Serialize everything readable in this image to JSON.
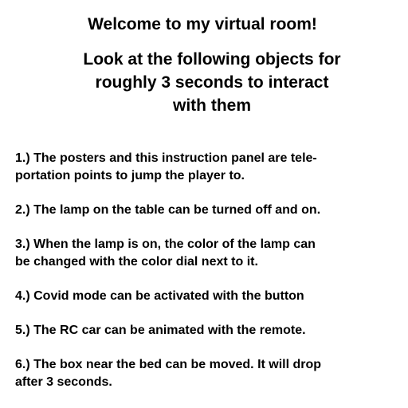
{
  "panel": {
    "title": "Welcome to my virtual room!",
    "subtitle_lines": [
      "Look at the following objects for",
      "roughly 3 seconds to interact",
      "with them"
    ],
    "instructions": [
      [
        "1.) The posters and this instruction panel are tele-",
        "portation points to jump the player to."
      ],
      [
        "2.) The lamp on the table can be turned off and on."
      ],
      [
        "3.) When the lamp is on, the color of the lamp can",
        "be changed with the color dial next to it."
      ],
      [
        "4.) Covid mode can be activated with the button"
      ],
      [
        "5.) The RC car can be animated with the remote."
      ],
      [
        "6.) The box near the bed can be moved. It will drop",
        "after 3 seconds."
      ]
    ]
  }
}
